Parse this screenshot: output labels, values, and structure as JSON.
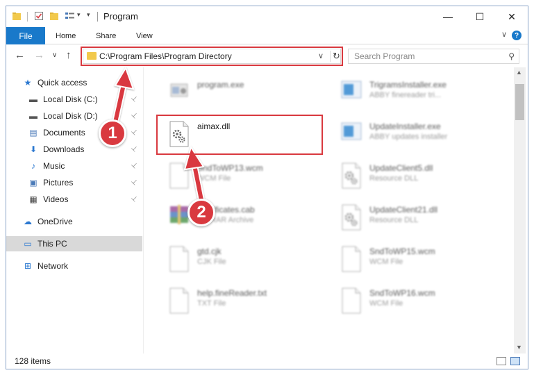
{
  "window": {
    "title": "Program",
    "minimize": "—",
    "maximize": "☐",
    "close": "✕"
  },
  "ribbon": {
    "file": "File",
    "tabs": [
      "Home",
      "Share",
      "View"
    ],
    "help": "?",
    "expand": "∨"
  },
  "nav": {
    "back": "←",
    "forward": "→",
    "recent": "∨",
    "up": "↑",
    "address": "C:\\Program Files\\Program Directory",
    "address_chevron": "∨",
    "refresh": "↻",
    "search_placeholder": "Search Program",
    "search_icon": "⚲"
  },
  "sidebar": {
    "items": [
      {
        "label": "Quick access",
        "icon": "star-icon",
        "glyph": "★",
        "color": "#2b78d0",
        "pinned": false
      },
      {
        "label": "Local Disk (C:)",
        "icon": "drive-icon",
        "glyph": "▬",
        "color": "#555555",
        "pinned": true
      },
      {
        "label": "Local Disk (D:)",
        "icon": "drive-icon",
        "glyph": "▬",
        "color": "#555555",
        "pinned": true
      },
      {
        "label": "Documents",
        "icon": "documents-icon",
        "glyph": "▤",
        "color": "#4a7ab8",
        "pinned": true
      },
      {
        "label": "Downloads",
        "icon": "download-icon",
        "glyph": "⬇",
        "color": "#2b78d0",
        "pinned": true
      },
      {
        "label": "Music",
        "icon": "music-icon",
        "glyph": "♪",
        "color": "#2b78d0",
        "pinned": true
      },
      {
        "label": "Pictures",
        "icon": "pictures-icon",
        "glyph": "▣",
        "color": "#4a7ab8",
        "pinned": true
      },
      {
        "label": "Videos",
        "icon": "video-icon",
        "glyph": "▦",
        "color": "#444444",
        "pinned": true
      },
      {
        "label": "OneDrive",
        "icon": "cloud-icon",
        "glyph": "☁",
        "color": "#2b78d0",
        "pinned": false
      },
      {
        "label": "This PC",
        "icon": "computer-icon",
        "glyph": "▭",
        "color": "#2b78d0",
        "pinned": false,
        "selected": true
      },
      {
        "label": "Network",
        "icon": "network-icon",
        "glyph": "⊞",
        "color": "#2b78d0",
        "pinned": false
      }
    ],
    "pin_glyph": "📌"
  },
  "files": [
    {
      "name": "program.exe",
      "type": "",
      "icon": "exe-icon",
      "blurred": true
    },
    {
      "name": "TrigramsInstaller.exe",
      "type": "ABBY finereader tri...",
      "icon": "installer-icon",
      "blurred": true
    },
    {
      "name": "aimax.dll",
      "type": "",
      "icon": "dll-gear-icon",
      "blurred": false
    },
    {
      "name": "UpdateInstaller.exe",
      "type": "ABBY updates installer",
      "icon": "installer-icon",
      "blurred": true
    },
    {
      "name": "SndToWP13.wcm",
      "type": "WCM File",
      "icon": "file-icon",
      "blurred": true
    },
    {
      "name": "UpdateClient5.dll",
      "type": "Resource DLL",
      "icon": "dll-icon",
      "blurred": true
    },
    {
      "name": "Certificates.cab",
      "type": "WinRAR Archive",
      "icon": "archive-icon",
      "blurred": true
    },
    {
      "name": "UpdateClient21.dll",
      "type": "Resource DLL",
      "icon": "dll-icon",
      "blurred": true
    },
    {
      "name": "gtd.cjk",
      "type": "CJK File",
      "icon": "file-icon",
      "blurred": true
    },
    {
      "name": "SndToWP15.wcm",
      "type": "WCM File",
      "icon": "file-icon",
      "blurred": true
    },
    {
      "name": "help.fineReader.txt",
      "type": "TXT File",
      "icon": "file-icon",
      "blurred": true
    },
    {
      "name": "SndToWP16.wcm",
      "type": "WCM File",
      "icon": "file-icon",
      "blurred": true
    }
  ],
  "status": {
    "count": "128 items"
  },
  "annotations": {
    "step1": "1",
    "step2": "2",
    "color": "#d9393f"
  }
}
